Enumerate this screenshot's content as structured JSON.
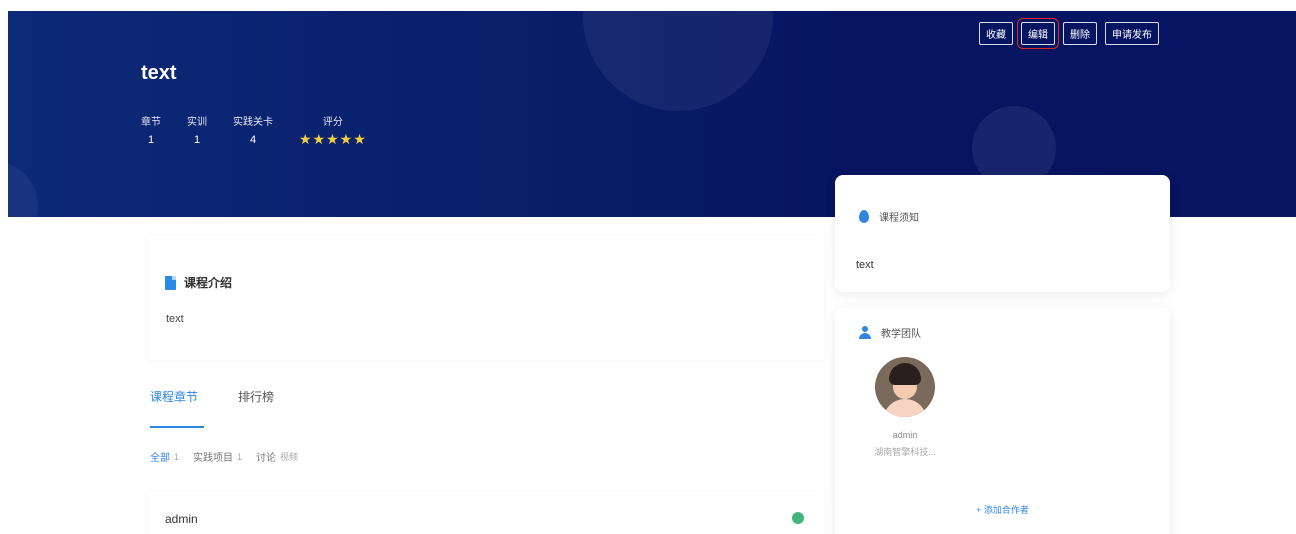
{
  "course": {
    "title": "text",
    "stats": [
      {
        "label": "章节",
        "value": "1"
      },
      {
        "label": "实训",
        "value": "1"
      },
      {
        "label": "实践关卡",
        "value": "4"
      }
    ],
    "rating_label": "评分",
    "rating_stars": "★★★★★",
    "rating_value": 5
  },
  "actions": {
    "favorite": "收藏",
    "edit": "编辑",
    "delete": "删除",
    "publish": "申请发布"
  },
  "intro": {
    "heading": "课程介绍",
    "text": "text"
  },
  "tabs": [
    {
      "label": "课程章节"
    },
    {
      "label": "排行榜"
    }
  ],
  "filters": [
    {
      "label": "全部",
      "count": "1"
    },
    {
      "label": "实践项目",
      "count": "1"
    },
    {
      "label": "讨论",
      "count": "视频"
    }
  ],
  "list": [
    {
      "name": "admin"
    }
  ],
  "notice": {
    "heading": "课程须知",
    "text": "text"
  },
  "team": {
    "heading": "教学团队",
    "members": [
      {
        "name": "admin",
        "org": "湖南智擎科技..."
      }
    ],
    "add_label": "+ 添加合作者"
  },
  "colors": {
    "hero": "#0a1f6b",
    "accent": "#2e86de",
    "star": "#f5d142",
    "highlight": "#e0251f",
    "status": "#42b67a"
  }
}
